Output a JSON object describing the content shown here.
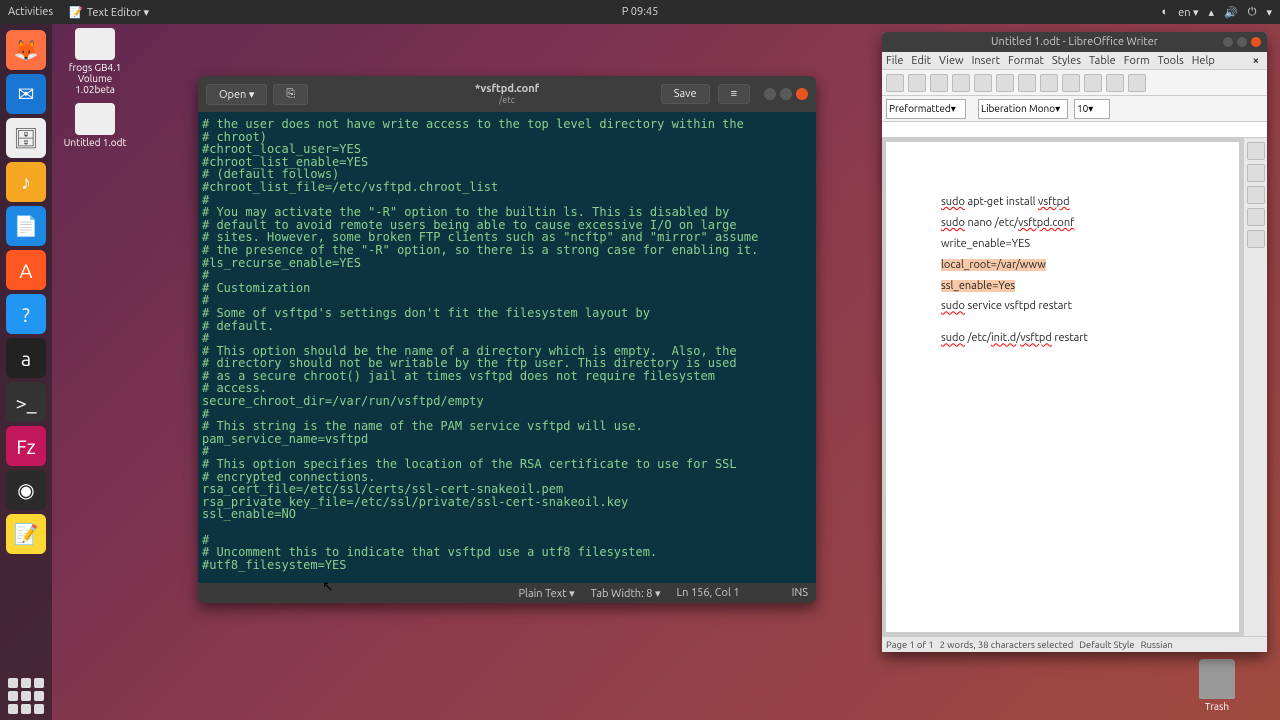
{
  "top_panel": {
    "activities": "Activities",
    "app_menu_icon": "📝",
    "app_menu_label": "Text Editor ▾",
    "clock": "P  09:45",
    "lang": "en ▾"
  },
  "desktop_icons": {
    "usb": "frogs GB4.1 Volume 1.02beta",
    "doc": "Untitled 1.odt",
    "trash": "Trash"
  },
  "gedit": {
    "open_label": "Open ▾",
    "save_label": "Save",
    "title": "*vsftpd.conf",
    "path": "/etc",
    "body": "# the user does not have write access to the top level directory within the\n# chroot)\n#chroot_local_user=YES\n#chroot_list_enable=YES\n# (default follows)\n#chroot_list_file=/etc/vsftpd.chroot_list\n#\n# You may activate the \"-R\" option to the builtin ls. This is disabled by\n# default to avoid remote users being able to cause excessive I/O on large\n# sites. However, some broken FTP clients such as \"ncftp\" and \"mirror\" assume\n# the presence of the \"-R\" option, so there is a strong case for enabling it.\n#ls_recurse_enable=YES\n#\n# Customization\n#\n# Some of vsftpd's settings don't fit the filesystem layout by\n# default.\n#\n# This option should be the name of a directory which is empty.  Also, the\n# directory should not be writable by the ftp user. This directory is used\n# as a secure chroot() jail at times vsftpd does not require filesystem\n# access.\nsecure_chroot_dir=/var/run/vsftpd/empty\n#\n# This string is the name of the PAM service vsftpd will use.\npam_service_name=vsftpd\n#\n# This option specifies the location of the RSA certificate to use for SSL\n# encrypted connections.\nrsa_cert_file=/etc/ssl/certs/ssl-cert-snakeoil.pem\nrsa_private_key_file=/etc/ssl/private/ssl-cert-snakeoil.key\nssl_enable=NO\n\n#\n# Uncomment this to indicate that vsftpd use a utf8 filesystem.\n#utf8_filesystem=YES",
    "status": {
      "lang": "Plain Text ▾",
      "tabwidth": "Tab Width: 8 ▾",
      "position": "Ln 156, Col 1",
      "ins": "INS"
    }
  },
  "libreoffice": {
    "title": "Untitled 1.odt - LibreOffice Writer",
    "menu": [
      "File",
      "Edit",
      "View",
      "Insert",
      "Format",
      "Styles",
      "Table",
      "Form",
      "Tools",
      "Help"
    ],
    "paragraph_style": "Preformatted",
    "font_name": "Liberation Mono",
    "font_size": "10",
    "lines": {
      "l1a": "sudo",
      "l1b": " apt-get install ",
      "l1c": "vsftpd",
      "l2a": "sudo",
      "l2b": " nano /etc/",
      "l2c": "vsftpd.conf",
      "l3": "write_enable=YES",
      "l4": "local_root=/var/www",
      "l5a": "ssl_enable=Yes",
      "l5b": "",
      "l6a": "sudo",
      "l6b": " service vsftpd restart",
      "l7a": "sudo",
      "l7b": " /etc/",
      "l7c": "init.d",
      "l7d": "/",
      "l7e": "vsftpd",
      "l7f": " restart"
    },
    "status": {
      "page": "Page 1 of 1",
      "words": "2 words, 38 characters selected",
      "style": "Default Style",
      "lang": "Russian"
    }
  }
}
